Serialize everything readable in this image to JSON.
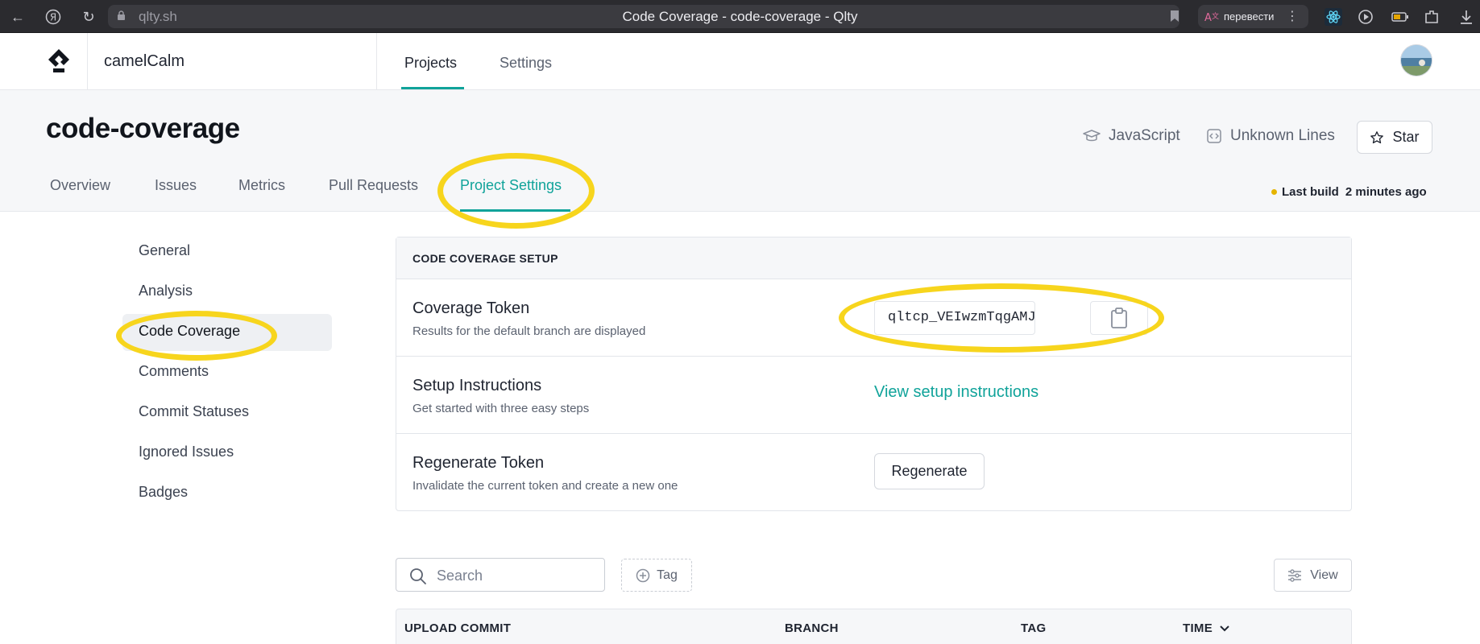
{
  "browser": {
    "url": "qlty.sh",
    "title": "Code Coverage - code-coverage - Qlty",
    "translate_label": "перевести"
  },
  "header": {
    "org_name": "camelCalm",
    "nav": [
      {
        "label": "Projects"
      },
      {
        "label": "Settings"
      }
    ]
  },
  "project": {
    "title": "code-coverage",
    "language": "JavaScript",
    "lines": "Unknown Lines",
    "star_label": "Star",
    "tabs": [
      {
        "label": "Overview"
      },
      {
        "label": "Issues"
      },
      {
        "label": "Metrics"
      },
      {
        "label": "Pull Requests"
      },
      {
        "label": "Project Settings"
      }
    ],
    "last_build_label": "Last build",
    "last_build_value": "2 minutes ago",
    "status_color": "#e5b400"
  },
  "settings_menu": [
    {
      "label": "General"
    },
    {
      "label": "Analysis"
    },
    {
      "label": "Code Coverage"
    },
    {
      "label": "Comments"
    },
    {
      "label": "Commit Statuses"
    },
    {
      "label": "Ignored Issues"
    },
    {
      "label": "Badges"
    }
  ],
  "coverage": {
    "heading": "CODE COVERAGE SETUP",
    "token_title": "Coverage Token",
    "token_subtitle": "Results for the default branch are displayed",
    "token_value": "qltcp_VEIwzmTqgAMJ",
    "setup_title": "Setup Instructions",
    "setup_subtitle": "Get started with three easy steps",
    "setup_link": "View setup instructions",
    "regen_title": "Regenerate Token",
    "regen_subtitle": "Invalidate the current token and create a new one",
    "regen_button": "Regenerate"
  },
  "toolbar": {
    "search_placeholder": "Search",
    "tag_label": "Tag",
    "view_label": "View"
  },
  "table": {
    "columns": [
      "UPLOAD COMMIT",
      "BRANCH",
      "TAG",
      "TIME"
    ]
  },
  "colors": {
    "accent": "#10a39a",
    "highlight": "#f7d51d"
  }
}
